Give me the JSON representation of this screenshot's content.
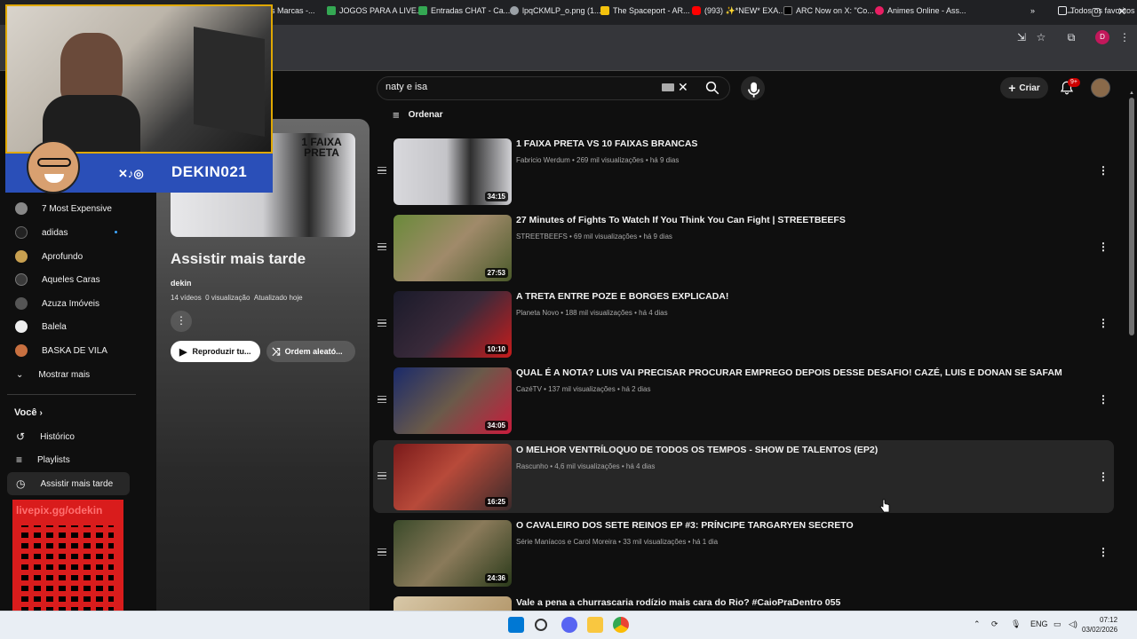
{
  "browser": {
    "bookmarks": [
      {
        "label": "es Marcas -...",
        "color": "#35363a"
      },
      {
        "label": "JOGOS PARA A LIVE...",
        "color": "#34a853"
      },
      {
        "label": "Entradas CHAT - Ca...",
        "color": "#34a853"
      },
      {
        "label": "lpqCKMLP_o.png (1...",
        "color": "#9aa0a6"
      },
      {
        "label": "The Spaceport - AR...",
        "color": "#f4c20d"
      },
      {
        "label": "(993) ✨*NEW* EXA...",
        "color": "#ff0000"
      },
      {
        "label": "ARC Now on X: \"Co...",
        "color": "#000000"
      },
      {
        "label": "Animes Online - Ass...",
        "color": "#e91e63"
      }
    ],
    "bookmarks_overflow": "»",
    "all_bookmarks": "Todos os favoritos",
    "profile_letter": "D"
  },
  "header": {
    "search_value": "naty e isa",
    "create_label": "Criar",
    "notif_count": "9+"
  },
  "overlay": {
    "handle": "DEKIN021",
    "qr_text": "livepix.gg/odekin"
  },
  "nav": {
    "items": [
      {
        "label": "7 Most Expensive",
        "color": "#888888"
      },
      {
        "label": "adidas",
        "color": "#222222"
      },
      {
        "label": "Aprofundo",
        "color": "#c8a050"
      },
      {
        "label": "Aqueles Caras",
        "color": "#3a3a3a"
      },
      {
        "label": "Azuza Imóveis",
        "color": "#555555"
      },
      {
        "label": "Balela",
        "color": "#eeeeee"
      },
      {
        "label": "BASKA DE VILA",
        "color": "#c87040"
      }
    ],
    "show_more": "Mostrar mais",
    "voce": "Você",
    "you_items": [
      {
        "label": "Histórico",
        "icon": "history-icon"
      },
      {
        "label": "Playlists",
        "icon": "playlists-icon"
      },
      {
        "label": "Assistir mais tarde",
        "icon": "clock-icon"
      }
    ]
  },
  "playlist": {
    "title": "Assistir mais tarde",
    "owner": "dekin",
    "videos": "14 vídeos",
    "views": "0 visualização",
    "updated": "Atualizado hoje",
    "play_label": "Reproduzir tu...",
    "shuffle_label": "Ordem aleató...",
    "thumb_text": "1 FAIXA PRETA"
  },
  "sort_label": "Ordenar",
  "videos": [
    {
      "title": "1 FAIXA PRETA VS 10 FAIXAS BRANCAS",
      "channel": "Fabricio Werdum",
      "views": "269 mil visualizações",
      "age": "há 9 dias",
      "duration": "34:15",
      "thumb": "#b9b9bd"
    },
    {
      "title": "27 Minutes of Fights To Watch If You Think You Can Fight | STREETBEEFS",
      "channel": "STREETBEEFS",
      "views": "69 mil visualizações",
      "age": "há 9 dias",
      "duration": "27:53",
      "thumb": "#7a8a4a"
    },
    {
      "title": "A TRETA ENTRE POZE E BORGES EXPLICADA!",
      "channel": "Planeta Novo",
      "views": "188 mil visualizações",
      "age": "há 4 dias",
      "duration": "10:10",
      "thumb": "#2a2a3a"
    },
    {
      "title": "QUAL É A NOTA? LUIS VAI PRECISAR PROCURAR EMPREGO DEPOIS DESSE DESAFIO! CAZÉ, LUIS E DONAN SE SAFAM",
      "channel": "CazéTV",
      "views": "137 mil visualizações",
      "age": "há 2 dias",
      "duration": "34:05",
      "thumb": "#1a2a6a"
    },
    {
      "title": "O MELHOR VENTRÍLOQUO DE TODOS OS TEMPOS - SHOW DE TALENTOS (EP2)",
      "channel": "Rascunho",
      "views": "4,6 mil visualizações",
      "age": "há 4 dias",
      "duration": "16:25",
      "thumb": "#8a2a2a"
    },
    {
      "title": "O CAVALEIRO DOS SETE REINOS EP #3: PRÍNCIPE TARGARYEN SECRETO",
      "channel": "Série Maníacos e Carol Moreira",
      "views": "33 mil visualizações",
      "age": "há 1 dia",
      "duration": "24:36",
      "thumb": "#4a5a3a"
    },
    {
      "title": "Vale a pena a churrascaria rodízio mais cara do Rio? #CaioPraDentro 055",
      "channel": "",
      "views": "",
      "age": "",
      "duration": "",
      "thumb": "#c8a878"
    }
  ],
  "taskbar": {
    "lang": "ENG",
    "time": "07:12",
    "date": "03/02/2026"
  }
}
